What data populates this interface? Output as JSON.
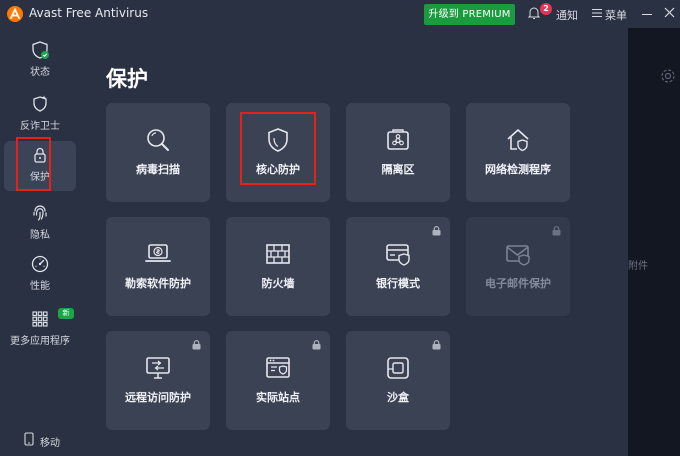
{
  "app": {
    "title": "Avast Free Antivirus",
    "upgrade_label": "升级到 PREMIUM",
    "notification_count": "2",
    "notify_label": "通知",
    "menu_label": "菜单",
    "accent_color": "#1a9c3e",
    "logo_color": "#ff7800"
  },
  "sidebar": {
    "items": [
      {
        "label": "状态",
        "icon": "shield-check-icon"
      },
      {
        "label": "反诈卫士",
        "icon": "shield-star-icon"
      },
      {
        "label": "保护",
        "icon": "lock-icon",
        "active": true
      },
      {
        "label": "隐私",
        "icon": "fingerprint-icon"
      },
      {
        "label": "性能",
        "icon": "speedometer-icon"
      },
      {
        "label": "更多应用程序",
        "icon": "grid-icon",
        "badge": "新"
      }
    ],
    "mobile_label": "移动"
  },
  "main": {
    "title": "保护",
    "tiles": [
      {
        "label": "病毒扫描",
        "icon": "magnifier-icon",
        "locked": false
      },
      {
        "label": "核心防护",
        "icon": "shield-icon",
        "locked": false,
        "highlighted": true
      },
      {
        "label": "隔离区",
        "icon": "biohazard-box-icon",
        "locked": false
      },
      {
        "label": "网络检测程序",
        "icon": "house-shield-icon",
        "locked": false
      },
      {
        "label": "勒索软件防护",
        "icon": "ransomware-laptop-icon",
        "locked": false
      },
      {
        "label": "防火墙",
        "icon": "brick-wall-icon",
        "locked": false
      },
      {
        "label": "银行模式",
        "icon": "bank-card-shield-icon",
        "locked": true
      },
      {
        "label": "电子邮件保护",
        "icon": "envelope-shield-icon",
        "locked": true,
        "disabled": true
      },
      {
        "label": "远程访问防护",
        "icon": "remote-desktop-icon",
        "locked": true
      },
      {
        "label": "实际站点",
        "icon": "browser-window-icon",
        "locked": true
      },
      {
        "label": "沙盒",
        "icon": "sandbox-icon",
        "locked": true
      }
    ]
  },
  "right_panel": {
    "text": "附件"
  }
}
